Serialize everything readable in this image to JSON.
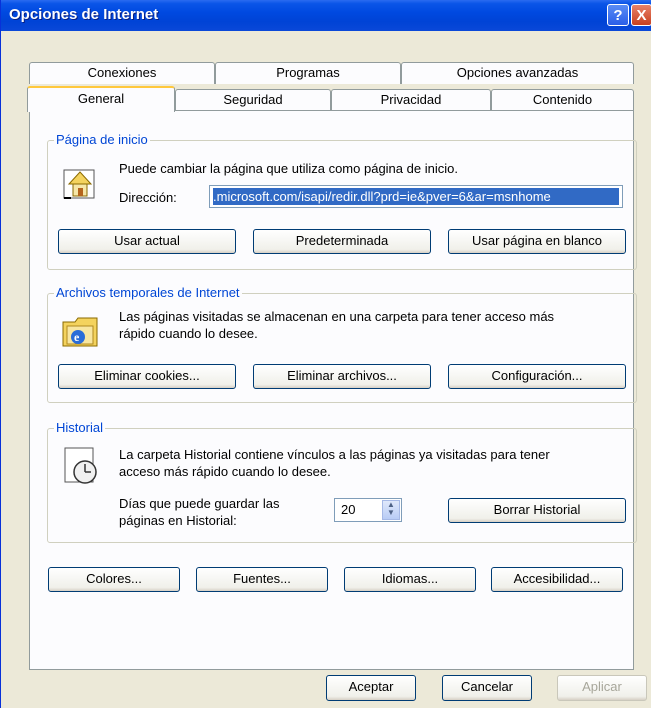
{
  "window": {
    "title": "Opciones de Internet",
    "help_glyph": "?",
    "close_glyph": "X"
  },
  "tabs_back": [
    "Conexiones",
    "Programas",
    "Opciones avanzadas"
  ],
  "tabs_front": [
    "General",
    "Seguridad",
    "Privacidad",
    "Contenido"
  ],
  "home": {
    "title": "Página de inicio",
    "description": "Puede cambiar la página que utiliza como página de inicio.",
    "address_label": "Dirección:",
    "address_value": ".microsoft.com/isapi/redir.dll?prd=ie&pver=6&ar=msnhome",
    "buttons": [
      "Usar actual",
      "Predeterminada",
      "Usar página en blanco"
    ]
  },
  "temp": {
    "title": "Archivos temporales de Internet",
    "description_1": "Las páginas visitadas se almacenan en una carpeta para tener acceso más",
    "description_2": "rápido cuando lo desee.",
    "buttons": [
      "Eliminar cookies...",
      "Eliminar archivos...",
      "Configuración..."
    ]
  },
  "history": {
    "title": "Historial",
    "description_1": "La carpeta Historial contiene vínculos a las páginas ya visitadas para tener",
    "description_2": "acceso más rápido cuando lo desee.",
    "days_label_1": "Días que puede guardar las",
    "days_label_2": "páginas en Historial:",
    "days_value": "20",
    "clear_button": "Borrar Historial"
  },
  "bottom_buttons": [
    "Colores...",
    "Fuentes...",
    "Idiomas...",
    "Accesibilidad..."
  ],
  "dialog_buttons": {
    "ok": "Aceptar",
    "cancel": "Cancelar",
    "apply": "Aplicar"
  },
  "colors": {
    "title_bar": "#0049e0",
    "group_title": "#0046d5",
    "selection": "#316ac5"
  }
}
